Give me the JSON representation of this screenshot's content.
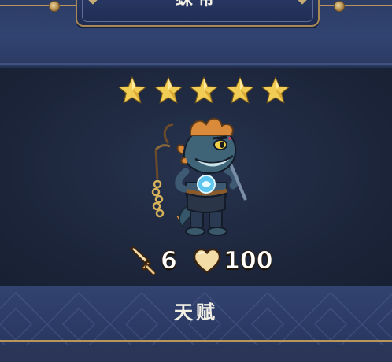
{
  "card": {
    "title": "蝾帝",
    "star_count": 5,
    "stars": [
      "★",
      "★",
      "★",
      "★",
      "★"
    ],
    "attack": "6",
    "health": "100",
    "talent_label": "天赋"
  },
  "icons": {
    "attack": "sword-icon",
    "health": "heart-icon",
    "star": "star-icon"
  },
  "colors": {
    "gold": "#e7c45a",
    "panel_dark": "#1b2439",
    "band_blue": "#2d3d65",
    "stat_text": "#ffffff"
  }
}
